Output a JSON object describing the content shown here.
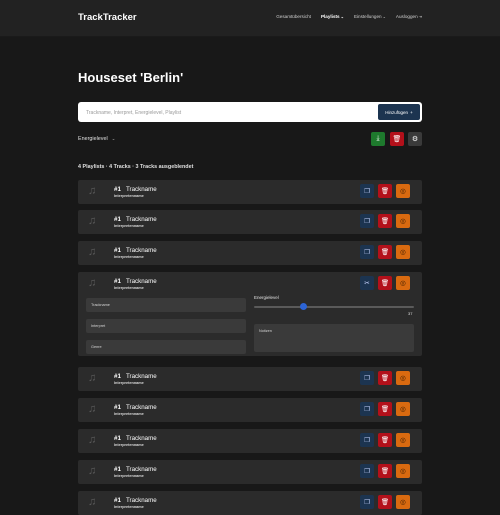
{
  "header": {
    "brand": "TrackTracker",
    "nav": [
      {
        "label": "Gesamtübersicht",
        "caret": "",
        "active": false
      },
      {
        "label": "Playlists",
        "caret": "⌄",
        "active": true
      },
      {
        "label": "Einstellungen",
        "caret": "⌄",
        "active": false
      },
      {
        "label": "Ausloggen",
        "caret": "⇥",
        "active": false
      }
    ]
  },
  "page": {
    "title": "Houseset 'Berlin'"
  },
  "search": {
    "placeholder": "Trackname, Interpret, Energielevel, Playlist",
    "value": "",
    "add_label": "Hinzufügen",
    "add_icon": "+"
  },
  "filter": {
    "label": "Energielevel",
    "caret": "⌄"
  },
  "toolbar": {
    "export_icon": "⤓",
    "delete_icon": "🗑",
    "settings_icon": "⚙"
  },
  "summary": "4 Playlists · 4 Tracks · 3 Tracks ausgeblendet",
  "tracks": [
    {
      "num": "#1",
      "name": "Trackname",
      "artist": "Interpretenname"
    },
    {
      "num": "#1",
      "name": "Trackname",
      "artist": "Interpretenname"
    },
    {
      "num": "#1",
      "name": "Trackname",
      "artist": "Interpretenname"
    },
    {
      "num": "#1",
      "name": "Trackname",
      "artist": "Interpretenname",
      "expanded": {
        "trackname_placeholder": "Trackname",
        "interpret_placeholder": "Interpret",
        "genre_placeholder": "Genre",
        "energy_label": "Energielevel",
        "energy_value": "37",
        "energy_fraction": 0.31,
        "notes_placeholder": "Notizen"
      }
    },
    {
      "num": "#1",
      "name": "Trackname",
      "artist": "Interpretenname"
    },
    {
      "num": "#1",
      "name": "Trackname",
      "artist": "Interpretenname"
    },
    {
      "num": "#1",
      "name": "Trackname",
      "artist": "Interpretenname"
    },
    {
      "num": "#1",
      "name": "Trackname",
      "artist": "Interpretenname"
    },
    {
      "num": "#1",
      "name": "Trackname",
      "artist": "Interpretenname"
    }
  ],
  "icons": {
    "note": "♫",
    "duplicate": "❐",
    "unlink": "✂",
    "delete": "🗑",
    "hide": "◎"
  },
  "colors": {
    "accent_navy": "#1c3450",
    "delete_red": "#b3101a",
    "hide_orange": "#d96a10",
    "export_green": "#1e7a2d",
    "slider_blue": "#2c64d6"
  }
}
